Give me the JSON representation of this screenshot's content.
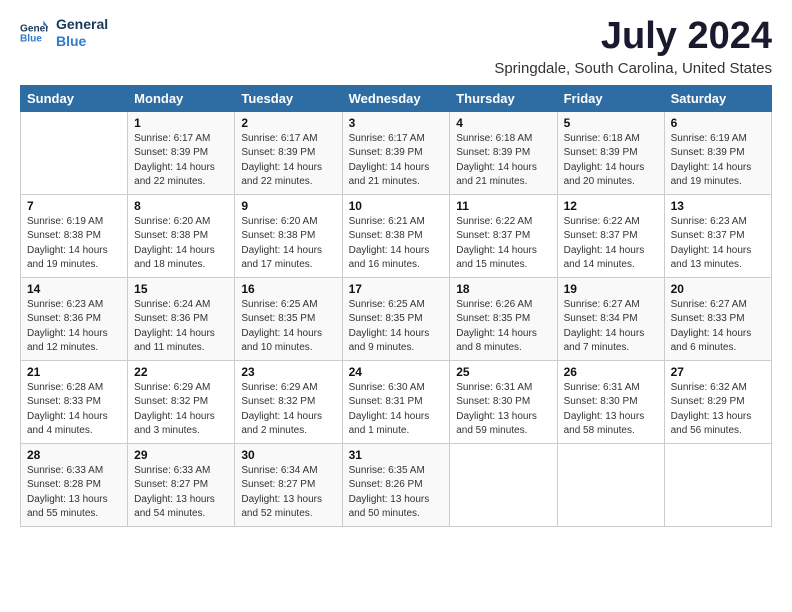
{
  "header": {
    "logo_line1": "General",
    "logo_line2": "Blue",
    "month": "July 2024",
    "location": "Springdale, South Carolina, United States"
  },
  "days_of_week": [
    "Sunday",
    "Monday",
    "Tuesday",
    "Wednesday",
    "Thursday",
    "Friday",
    "Saturday"
  ],
  "weeks": [
    [
      {
        "day": "",
        "info": ""
      },
      {
        "day": "1",
        "info": "Sunrise: 6:17 AM\nSunset: 8:39 PM\nDaylight: 14 hours\nand 22 minutes."
      },
      {
        "day": "2",
        "info": "Sunrise: 6:17 AM\nSunset: 8:39 PM\nDaylight: 14 hours\nand 22 minutes."
      },
      {
        "day": "3",
        "info": "Sunrise: 6:17 AM\nSunset: 8:39 PM\nDaylight: 14 hours\nand 21 minutes."
      },
      {
        "day": "4",
        "info": "Sunrise: 6:18 AM\nSunset: 8:39 PM\nDaylight: 14 hours\nand 21 minutes."
      },
      {
        "day": "5",
        "info": "Sunrise: 6:18 AM\nSunset: 8:39 PM\nDaylight: 14 hours\nand 20 minutes."
      },
      {
        "day": "6",
        "info": "Sunrise: 6:19 AM\nSunset: 8:39 PM\nDaylight: 14 hours\nand 19 minutes."
      }
    ],
    [
      {
        "day": "7",
        "info": "Sunrise: 6:19 AM\nSunset: 8:38 PM\nDaylight: 14 hours\nand 19 minutes."
      },
      {
        "day": "8",
        "info": "Sunrise: 6:20 AM\nSunset: 8:38 PM\nDaylight: 14 hours\nand 18 minutes."
      },
      {
        "day": "9",
        "info": "Sunrise: 6:20 AM\nSunset: 8:38 PM\nDaylight: 14 hours\nand 17 minutes."
      },
      {
        "day": "10",
        "info": "Sunrise: 6:21 AM\nSunset: 8:38 PM\nDaylight: 14 hours\nand 16 minutes."
      },
      {
        "day": "11",
        "info": "Sunrise: 6:22 AM\nSunset: 8:37 PM\nDaylight: 14 hours\nand 15 minutes."
      },
      {
        "day": "12",
        "info": "Sunrise: 6:22 AM\nSunset: 8:37 PM\nDaylight: 14 hours\nand 14 minutes."
      },
      {
        "day": "13",
        "info": "Sunrise: 6:23 AM\nSunset: 8:37 PM\nDaylight: 14 hours\nand 13 minutes."
      }
    ],
    [
      {
        "day": "14",
        "info": "Sunrise: 6:23 AM\nSunset: 8:36 PM\nDaylight: 14 hours\nand 12 minutes."
      },
      {
        "day": "15",
        "info": "Sunrise: 6:24 AM\nSunset: 8:36 PM\nDaylight: 14 hours\nand 11 minutes."
      },
      {
        "day": "16",
        "info": "Sunrise: 6:25 AM\nSunset: 8:35 PM\nDaylight: 14 hours\nand 10 minutes."
      },
      {
        "day": "17",
        "info": "Sunrise: 6:25 AM\nSunset: 8:35 PM\nDaylight: 14 hours\nand 9 minutes."
      },
      {
        "day": "18",
        "info": "Sunrise: 6:26 AM\nSunset: 8:35 PM\nDaylight: 14 hours\nand 8 minutes."
      },
      {
        "day": "19",
        "info": "Sunrise: 6:27 AM\nSunset: 8:34 PM\nDaylight: 14 hours\nand 7 minutes."
      },
      {
        "day": "20",
        "info": "Sunrise: 6:27 AM\nSunset: 8:33 PM\nDaylight: 14 hours\nand 6 minutes."
      }
    ],
    [
      {
        "day": "21",
        "info": "Sunrise: 6:28 AM\nSunset: 8:33 PM\nDaylight: 14 hours\nand 4 minutes."
      },
      {
        "day": "22",
        "info": "Sunrise: 6:29 AM\nSunset: 8:32 PM\nDaylight: 14 hours\nand 3 minutes."
      },
      {
        "day": "23",
        "info": "Sunrise: 6:29 AM\nSunset: 8:32 PM\nDaylight: 14 hours\nand 2 minutes."
      },
      {
        "day": "24",
        "info": "Sunrise: 6:30 AM\nSunset: 8:31 PM\nDaylight: 14 hours\nand 1 minute."
      },
      {
        "day": "25",
        "info": "Sunrise: 6:31 AM\nSunset: 8:30 PM\nDaylight: 13 hours\nand 59 minutes."
      },
      {
        "day": "26",
        "info": "Sunrise: 6:31 AM\nSunset: 8:30 PM\nDaylight: 13 hours\nand 58 minutes."
      },
      {
        "day": "27",
        "info": "Sunrise: 6:32 AM\nSunset: 8:29 PM\nDaylight: 13 hours\nand 56 minutes."
      }
    ],
    [
      {
        "day": "28",
        "info": "Sunrise: 6:33 AM\nSunset: 8:28 PM\nDaylight: 13 hours\nand 55 minutes."
      },
      {
        "day": "29",
        "info": "Sunrise: 6:33 AM\nSunset: 8:27 PM\nDaylight: 13 hours\nand 54 minutes."
      },
      {
        "day": "30",
        "info": "Sunrise: 6:34 AM\nSunset: 8:27 PM\nDaylight: 13 hours\nand 52 minutes."
      },
      {
        "day": "31",
        "info": "Sunrise: 6:35 AM\nSunset: 8:26 PM\nDaylight: 13 hours\nand 50 minutes."
      },
      {
        "day": "",
        "info": ""
      },
      {
        "day": "",
        "info": ""
      },
      {
        "day": "",
        "info": ""
      }
    ]
  ]
}
